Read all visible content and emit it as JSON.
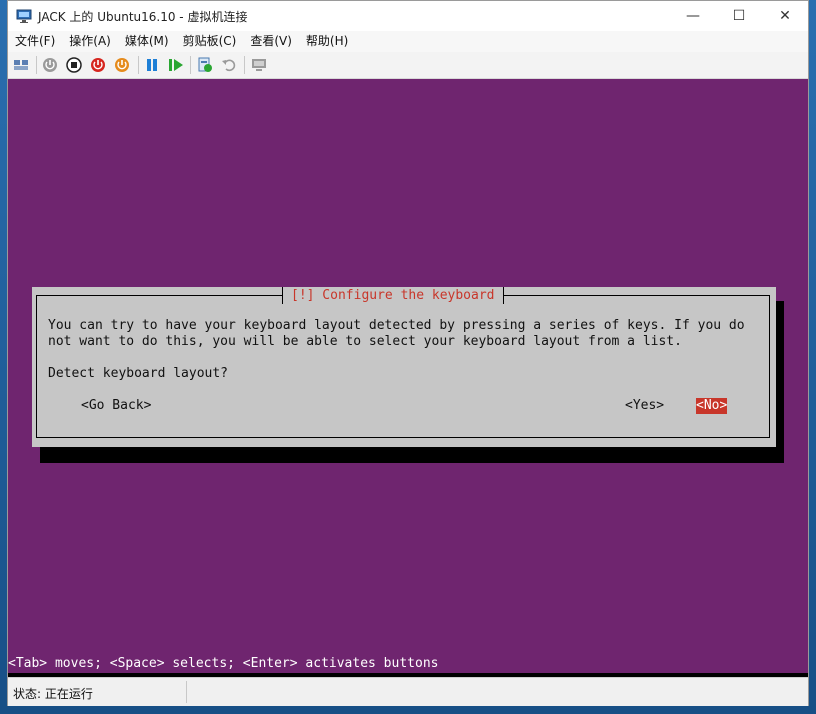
{
  "window": {
    "title": "JACK 上的 Ubuntu16.10 - 虚拟机连接",
    "minimize_glyph": "—",
    "maximize_glyph": "☐",
    "close_glyph": "✕"
  },
  "menubar": {
    "items": [
      "文件(F)",
      "操作(A)",
      "媒体(M)",
      "剪贴板(C)",
      "查看(V)",
      "帮助(H)"
    ]
  },
  "toolbar": {
    "icons": [
      "ctrl-alt-del-icon",
      "start-icon",
      "turn-off-icon",
      "shutdown-icon",
      "save-icon",
      "pause-icon",
      "resume-icon",
      "checkpoint-icon",
      "revert-icon",
      "enhanced-session-icon"
    ]
  },
  "installer": {
    "dialog_title": "[!] Configure the keyboard",
    "line1": "You can try to have your keyboard layout detected by pressing a series of keys. If you do",
    "line2": "not want to do this, you will be able to select your keyboard layout from a list.",
    "question": "Detect keyboard layout?",
    "go_back": "<Go Back>",
    "yes": "<Yes>",
    "no": "<No>",
    "hint": "<Tab> moves; <Space> selects; <Enter> activates buttons"
  },
  "statusbar": {
    "text": "状态: 正在运行"
  },
  "colors": {
    "vm_background": "#6f256f",
    "dialog_background": "#c6c6c6",
    "accent_red": "#c8362a"
  }
}
